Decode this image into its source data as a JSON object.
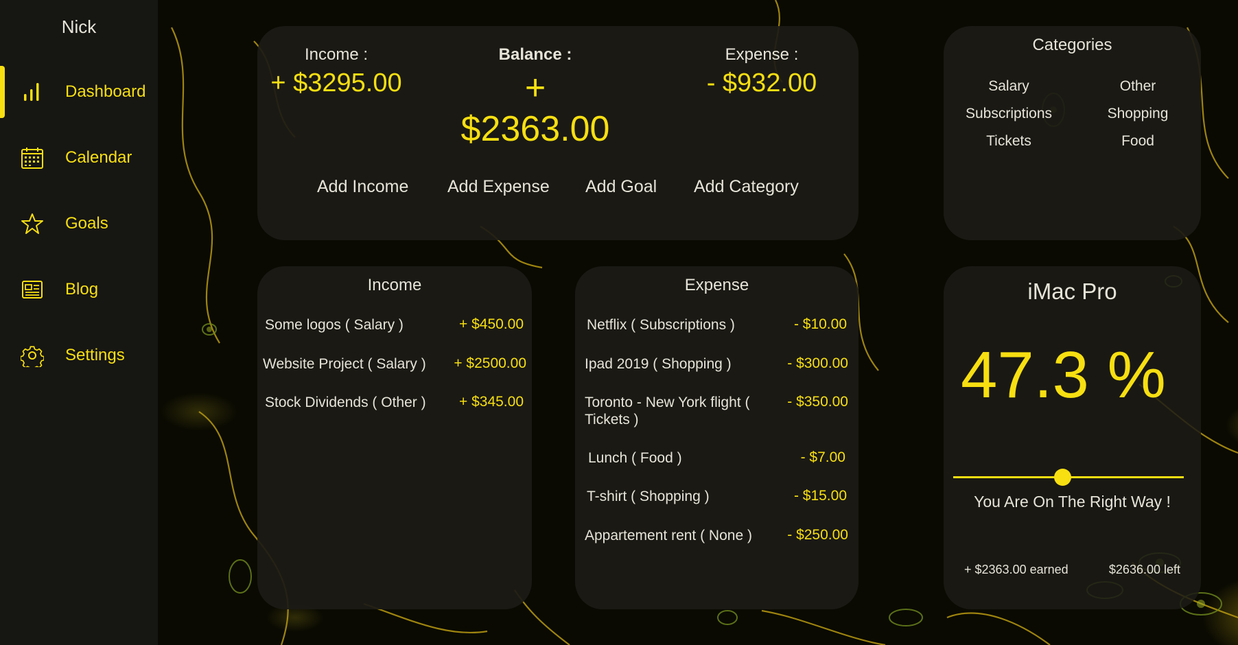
{
  "sidebar": {
    "user_name": "Nick",
    "items": [
      {
        "label": "Dashboard",
        "icon": "bar-chart-icon",
        "active": true
      },
      {
        "label": "Calendar",
        "icon": "calendar-icon",
        "active": false
      },
      {
        "label": "Goals",
        "icon": "star-icon",
        "active": false
      },
      {
        "label": "Blog",
        "icon": "newspaper-icon",
        "active": false
      },
      {
        "label": "Settings",
        "icon": "gear-icon",
        "active": false
      }
    ]
  },
  "summary": {
    "income_label": "Income :",
    "income_value": "+ $3295.00",
    "balance_label": "Balance :",
    "balance_value": "+ $2363.00",
    "expense_label": "Expense :",
    "expense_value": "- $932.00",
    "actions": [
      "Add Income",
      "Add Expense",
      "Add Goal",
      "Add Category"
    ]
  },
  "categories": {
    "title": "Categories",
    "items": [
      "Salary",
      "Other",
      "Subscriptions",
      "Shopping",
      "Tickets",
      "Food"
    ]
  },
  "income": {
    "title": "Income",
    "rows": [
      {
        "name": "Some logos ( Salary )",
        "amount": "+ $450.00"
      },
      {
        "name": "Website Project ( Salary )",
        "amount": "+ $2500.00"
      },
      {
        "name": "Stock Dividends ( Other )",
        "amount": "+ $345.00"
      }
    ]
  },
  "expense": {
    "title": "Expense",
    "rows": [
      {
        "name": "Netflix ( Subscriptions )",
        "amount": "- $10.00"
      },
      {
        "name": "Ipad 2019 ( Shopping )",
        "amount": "- $300.00"
      },
      {
        "name": "Toronto - New York flight ( Tickets )",
        "amount": "- $350.00"
      },
      {
        "name": "Lunch ( Food )",
        "amount": "- $7.00"
      },
      {
        "name": "T-shirt ( Shopping )",
        "amount": "- $15.00"
      },
      {
        "name": "Appartement rent ( None )",
        "amount": "- $250.00"
      }
    ]
  },
  "goal": {
    "title": "iMac Pro",
    "percent_text": "47.3 %",
    "progress": 0.473,
    "message": "You Are On The Right Way !",
    "earned": "+ $2363.00 earned",
    "left": "$2636.00 left"
  },
  "colors": {
    "accent": "#f7df11",
    "sidebar_bg": "#161613",
    "card_bg": "#1c1b16",
    "text": "#e6e4d8"
  }
}
